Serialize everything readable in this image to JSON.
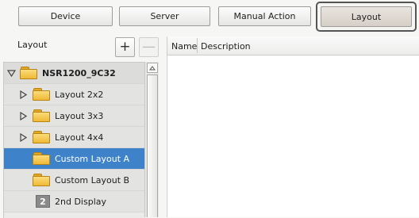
{
  "tabs": [
    {
      "label": "Device"
    },
    {
      "label": "Server"
    },
    {
      "label": "Manual Action"
    },
    {
      "label": "Layout"
    }
  ],
  "active_tab": "Layout",
  "left_panel": {
    "title": "Layout",
    "add_label": "+",
    "remove_label": "—",
    "tree": [
      {
        "label": "NSR1200_9C32",
        "type": "root",
        "expanded": true
      },
      {
        "label": "Layout 2x2",
        "type": "folder",
        "expanded": false
      },
      {
        "label": "Layout 3x3",
        "type": "folder",
        "expanded": false
      },
      {
        "label": "Layout 4x4",
        "type": "folder",
        "expanded": false
      },
      {
        "label": "Custom Layout A",
        "type": "folder",
        "selected": true
      },
      {
        "label": "Custom Layout B",
        "type": "folder"
      },
      {
        "label": "2nd Display",
        "type": "display",
        "badge": "2"
      }
    ]
  },
  "table": {
    "columns": [
      "Name",
      "Description"
    ]
  },
  "colors": {
    "selection": "#3e82c9",
    "folder": "#f0b936"
  }
}
